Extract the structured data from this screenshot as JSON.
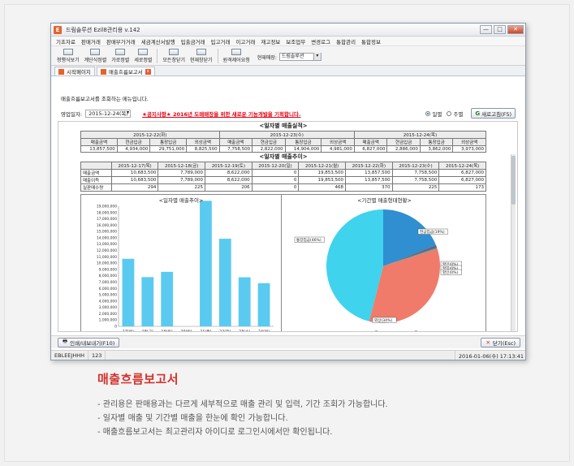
{
  "window": {
    "app_icon": "E",
    "title": "드림솔루션 Ezil8관리용 v.142",
    "controls": [
      "—",
      "□",
      "✕"
    ]
  },
  "menu": [
    "기초자료",
    "판매거래",
    "판매부가거래",
    "세금계산서발행",
    "입출금거래",
    "입고거래",
    "이고거래",
    "재고정보",
    "보조업무",
    "변경로그",
    "통합관리",
    "통합정보"
  ],
  "toolbar": {
    "buttons": [
      "청행식보기",
      "계단식정렬",
      "가로정렬",
      "세로정렬",
      "모든창닫기",
      "현재창닫기",
      "원격제어요청"
    ],
    "store_label": "현재매장:",
    "store_value": "드림솔루션"
  },
  "tabs": [
    {
      "label": "시작페이지"
    },
    {
      "label": "매출흐름보고서"
    }
  ],
  "content": {
    "info": "매출흐름보고서를 조회하는 메뉴입니다.",
    "date_label": "영업일자:",
    "date_value": "2015-12-24(목)",
    "notice": "★공지사항★ 2016년 도매매장을 위한 새로운 기능개발을 기획합니다.",
    "radio_daily": "일별",
    "radio_weekly": "주별",
    "refresh": "새로고침(F5)"
  },
  "daily_sales": {
    "title": "<일자별 매출실적>",
    "dates": [
      "2015-12-22(화)",
      "2015-12-23(수)",
      "2015-12-24(목)"
    ],
    "headers": [
      "매출금액",
      "현금입금",
      "통장입금",
      "외상금액"
    ],
    "rows": [
      [
        "13,857,500",
        "4,934,000",
        "29,751,000",
        "8,825,500"
      ],
      [
        "7,758,500",
        "2,822,000",
        "14,904,000",
        "4,981,000"
      ],
      [
        "6,827,000",
        "2,886,000",
        "3,862,000",
        "3,973,000"
      ]
    ]
  },
  "sales_trend": {
    "title": "<일자별 매출추이>",
    "dates": [
      "2015-12-17(목)",
      "2015-12-18(금)",
      "2015-12-19(토)",
      "2015-12-20(일)",
      "2015-12-21(월)",
      "2015-12-22(화)",
      "2015-12-23(수)",
      "2015-12-24(목)"
    ],
    "rows": [
      {
        "label": "매출금액",
        "values": [
          "10,683,500",
          "7,789,000",
          "8,622,000",
          "0",
          "19,853,500",
          "13,857,500",
          "7,758,500",
          "6,827,000"
        ]
      },
      {
        "label": "매출이득",
        "values": [
          "10,683,500",
          "7,789,000",
          "8,622,000",
          "0",
          "19,853,500",
          "13,857,500",
          "7,758,500",
          "6,827,000"
        ]
      },
      {
        "label": "실판매수량",
        "values": [
          "294",
          "225",
          "206",
          "0",
          "468",
          "370",
          "225",
          "173"
        ]
      }
    ]
  },
  "chart_data": [
    {
      "type": "bar",
      "title": "<일자별 매출추이>",
      "categories": [
        "17(목)",
        "18(금)",
        "19(토)",
        "20(일)",
        "21(월)",
        "22(화)",
        "23(수)",
        "24(목)"
      ],
      "values": [
        10683500,
        7789000,
        8622000,
        0,
        19853500,
        13857500,
        7758500,
        6827000
      ],
      "ylim": [
        0,
        19000000
      ],
      "yticks": [
        "19,000,000",
        "18,000,000",
        "17,000,000",
        "16,000,000",
        "15,000,000",
        "14,000,000",
        "13,000,000",
        "12,000,000",
        "11,000,000",
        "10,000,000",
        "9,000,000",
        "8,000,000",
        "7,000,000",
        "6,000,000",
        "5,000,000",
        "4,000,000",
        "3,000,000",
        "2,000,000",
        "1,000,000",
        "0"
      ],
      "color": "#5bcaf0"
    },
    {
      "type": "pie",
      "title": "<기간별 매출형태현황>",
      "subtitle": "2015-12-17(목) ~ 2015-12-24(목)",
      "slices": [
        {
          "label": "현금입금(19%)",
          "value": 19,
          "color": "#2f8fd0"
        },
        {
          "label": "할인(0%)",
          "value": 0.4,
          "color": "#8a4a4a"
        },
        {
          "label": "할입(0%)",
          "value": 0.3,
          "color": "#3a6aa0"
        },
        {
          "label": "할인(0%)",
          "value": 0.3,
          "color": "#4aa0a0"
        },
        {
          "label": "외상(34%)",
          "value": 34,
          "color": "#f07b6a"
        },
        {
          "label": "통장입금(46%)",
          "value": 46,
          "color": "#3fd3ee"
        }
      ]
    }
  ],
  "bottom": {
    "print_button": "인쇄/내보내기(F10)",
    "close_button": "닫기(Esc)"
  },
  "status": {
    "user": "EBLEEJHHH",
    "code": "123",
    "datetime": "2016-01-06(수) 17:13:41"
  },
  "caption": {
    "title": "매출흐름보고서",
    "items": [
      "- 관리용은 판매용과는 다르게 세부적으로 매출 관리 및 입력, 기간 조회가 가능합니다.",
      "- 일자별 매출 및 기간별 매출을 한눈에 확인 가능합니다.",
      "- 매출흐름보고서는 최고관리자 아이디로 로그인시에서만 확인됩니다."
    ]
  }
}
